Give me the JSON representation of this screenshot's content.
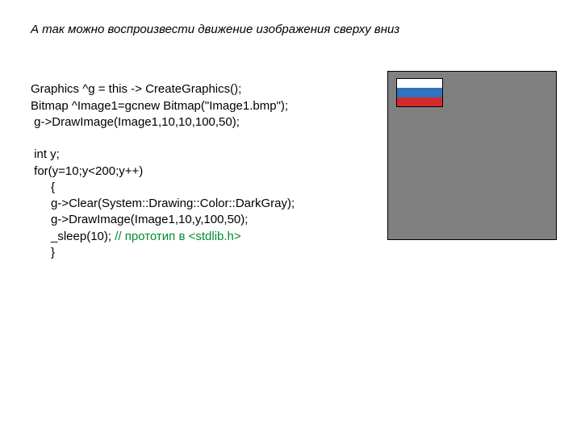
{
  "heading": "А так можно воспроизвести движение изображения сверху вниз",
  "code": {
    "l1": "Graphics ^g = this -> CreateGraphics();",
    "l2": "Bitmap ^Image1=gcnew Bitmap(\"Image1.bmp\");",
    "l3": " g->DrawImage(Image1,10,10,100,50);",
    "l4": "",
    "l5": " int y;",
    "l6": " for(y=10;y<200;y++)",
    "l7": "      {",
    "l8": "      g->Clear(System::Drawing::Color::DarkGray);",
    "l9": "      g->DrawImage(Image1,10,y,100,50);",
    "l10a": "      _sleep(10); ",
    "l10b": "// прототип в <stdlib.h>",
    "l11": "      }"
  },
  "canvas_bg": "#808080",
  "flag_colors": {
    "top": "#ffffff",
    "mid": "#2f74c0",
    "bot": "#d42a2a"
  }
}
